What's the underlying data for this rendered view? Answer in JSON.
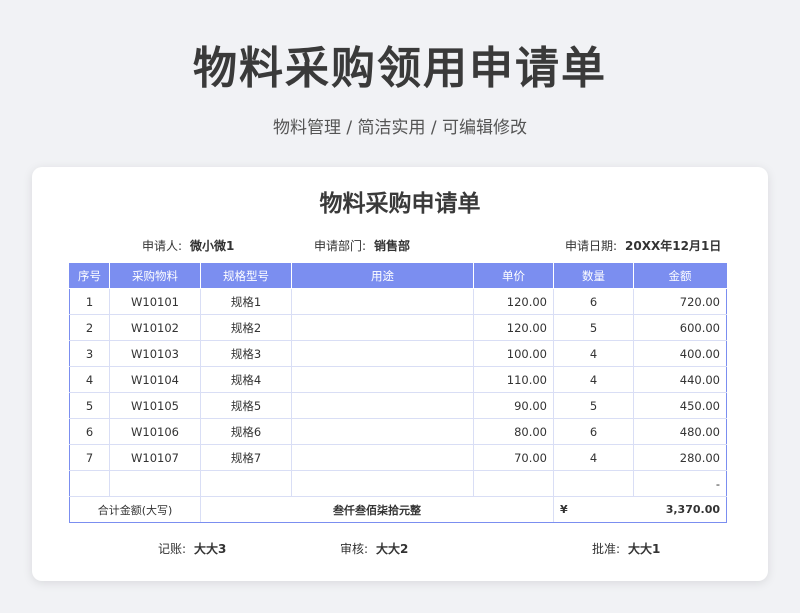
{
  "header": {
    "title": "物料采购领用申请单",
    "subtitle": "物料管理 / 简洁实用 / 可编辑修改"
  },
  "form": {
    "title": "物料采购申请单",
    "applicant_label": "申请人:",
    "applicant": "微小微1",
    "dept_label": "申请部门:",
    "dept": "销售部",
    "date_label": "申请日期:",
    "date": "20XX年12月1日"
  },
  "table": {
    "headers": [
      "序号",
      "采购物料",
      "规格型号",
      "用途",
      "单价",
      "数量",
      "金额"
    ],
    "rows": [
      [
        "1",
        "W10101",
        "规格1",
        "",
        "120.00",
        "6",
        "720.00"
      ],
      [
        "2",
        "W10102",
        "规格2",
        "",
        "120.00",
        "5",
        "600.00"
      ],
      [
        "3",
        "W10103",
        "规格3",
        "",
        "100.00",
        "4",
        "400.00"
      ],
      [
        "4",
        "W10104",
        "规格4",
        "",
        "110.00",
        "4",
        "440.00"
      ],
      [
        "5",
        "W10105",
        "规格5",
        "",
        "90.00",
        "5",
        "450.00"
      ],
      [
        "6",
        "W10106",
        "规格6",
        "",
        "80.00",
        "6",
        "480.00"
      ],
      [
        "7",
        "W10107",
        "规格7",
        "",
        "70.00",
        "4",
        "280.00"
      ]
    ],
    "blank_dash": "-",
    "total_label": "合计金额(大写)",
    "total_caps": "叁仟叁佰柒拾元整",
    "currency": "¥",
    "total_amount": "3,370.00"
  },
  "footer": {
    "bookkeeper_label": "记账:",
    "bookkeeper": "大大3",
    "reviewer_label": "审核:",
    "reviewer": "大大2",
    "approver_label": "批准:",
    "approver": "大大1"
  },
  "colors": {
    "header_bg": "#7b8ef0",
    "grid": "#d9def5"
  }
}
